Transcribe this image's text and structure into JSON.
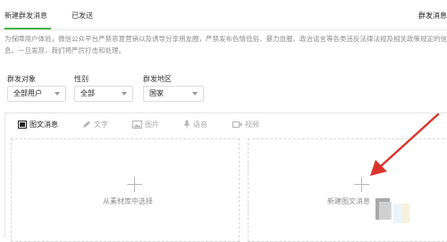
{
  "tabs": {
    "new_mass": "新建群发消息",
    "sent": "已发送",
    "right": "群发消息"
  },
  "notice": {
    "line1": "为保障用户体验，微信公众平台严禁恶意营销以及诱导分享朋友圈，严禁发布色情低俗、暴力血腥、政治谣言等各类违反法律法规及相关政策规定的信",
    "line2": "息。一旦发现，我们将严厉打击和处理。"
  },
  "filters": {
    "target": {
      "label": "群发对象",
      "value": "全部用户"
    },
    "gender": {
      "label": "性别",
      "value": "全部"
    },
    "region": {
      "label": "群发地区",
      "value": "国家"
    }
  },
  "toolbar": {
    "article": "图文消息",
    "text": "文字",
    "image": "图片",
    "voice": "语音",
    "video": "视频"
  },
  "panels": {
    "left": "从素材库中选择",
    "right": "新建图文消息"
  },
  "colors": {
    "accent": "#44b549",
    "arrow": "#d9342b"
  }
}
